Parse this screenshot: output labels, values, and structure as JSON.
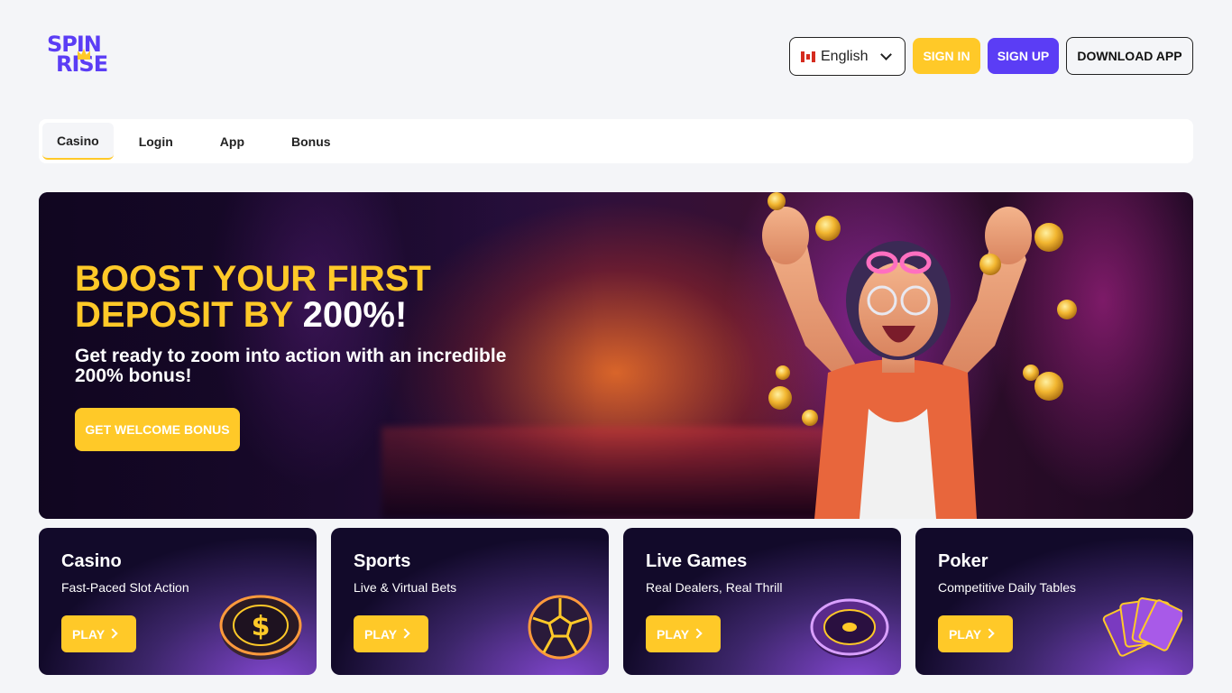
{
  "header": {
    "logo_line1": "SPIN",
    "logo_line2": "RISE",
    "language": "English",
    "sign_in": "SIGN IN",
    "sign_up": "SIGN UP",
    "download": "DOWNLOAD APP"
  },
  "tabs": [
    {
      "label": "Casino",
      "active": true
    },
    {
      "label": "Login"
    },
    {
      "label": "App"
    },
    {
      "label": "Bonus"
    }
  ],
  "hero": {
    "title_part1": "BOOST YOUR FIRST DEPOSIT BY ",
    "title_highlight": "200%!",
    "subtitle": "Get ready to zoom into action with an incredible 200% bonus!",
    "button": "GET WELCOME BONUS"
  },
  "cards": [
    {
      "title": "Casino",
      "subtitle": "Fast-Paced Slot Action",
      "button": "PLAY",
      "icon": "casino-chip-icon"
    },
    {
      "title": "Sports",
      "subtitle": "Live & Virtual Bets",
      "button": "PLAY",
      "icon": "soccer-ball-icon"
    },
    {
      "title": "Live Games",
      "subtitle": "Real Dealers, Real Thrill",
      "button": "PLAY",
      "icon": "roulette-wheel-icon"
    },
    {
      "title": "Poker",
      "subtitle": "Competitive Daily Tables",
      "button": "PLAY",
      "icon": "playing-cards-icon"
    }
  ],
  "colors": {
    "accent_yellow": "#ffc928",
    "brand_purple": "#5b3df5",
    "background": "#f4f5f8"
  }
}
